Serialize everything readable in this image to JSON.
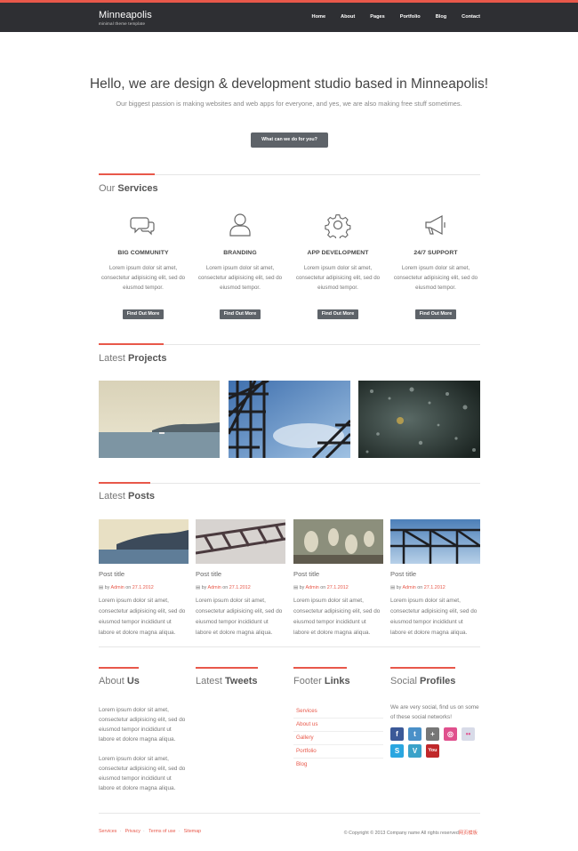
{
  "header": {
    "logo": "Minneapolis",
    "tagline": "minimal theme template",
    "nav": [
      "Home",
      "About",
      "Pages",
      "Portfolio",
      "Blog",
      "Contact"
    ]
  },
  "hero": {
    "title": "Hello, we are design & development studio based in Minneapolis!",
    "subtitle": "Our biggest passion is making websites and web apps for everyone, and yes, we are also making free stuff sometimes.",
    "button": "What can we do for you?"
  },
  "services": {
    "title_light": "Our",
    "title_bold": "Services",
    "items": [
      {
        "icon": "chat-bubbles-icon",
        "title": "BIG COMMUNITY",
        "text": "Lorem ipsum dolor sit amet, consectetur adipisicing elit, sed do eiusmod tempor.",
        "button": "Find Out More"
      },
      {
        "icon": "user-icon",
        "title": "BRANDING",
        "text": "Lorem ipsum dolor sit amet, consectetur adipisicing elit, sed do eiusmod tempor.",
        "button": "Find Out More"
      },
      {
        "icon": "gear-icon",
        "title": "APP DEVELOPMENT",
        "text": "Lorem ipsum dolor sit amet, consectetur adipisicing elit, sed do eiusmod tempor.",
        "button": "Find Out More"
      },
      {
        "icon": "megaphone-icon",
        "title": "24/7 SUPPORT",
        "text": "Lorem ipsum dolor sit amet, consectetur adipisicing elit, sed do eiusmod tempor.",
        "button": "Find Out More"
      }
    ]
  },
  "projects": {
    "title_light": "Latest",
    "title_bold": "Projects"
  },
  "posts": {
    "title_light": "Latest",
    "title_bold": "Posts",
    "items": [
      {
        "title": "Post title",
        "by": "by",
        "author": "Admin",
        "on": "on",
        "date": "27.1.2012",
        "text": "Lorem ipsum dolor sit amet, consectetur adipisicing elit, sed do eiusmod tempor incididunt ut labore et dolore magna aliqua."
      },
      {
        "title": "Post title",
        "by": "by",
        "author": "Admin",
        "on": "on",
        "date": "27.1.2012",
        "text": "Lorem ipsum dolor sit amet, consectetur adipisicing elit, sed do eiusmod tempor incididunt ut labore et dolore magna aliqua."
      },
      {
        "title": "Post title",
        "by": "by",
        "author": "Admin",
        "on": "on",
        "date": "27.1.2012",
        "text": "Lorem ipsum dolor sit amet, consectetur adipisicing elit, sed do eiusmod tempor incididunt ut labore et dolore magna aliqua."
      },
      {
        "title": "Post title",
        "by": "by",
        "author": "Admin",
        "on": "on",
        "date": "27.1.2012",
        "text": "Lorem ipsum dolor sit amet, consectetur adipisicing elit, sed do eiusmod tempor incididunt ut labore et dolore magna aliqua."
      }
    ]
  },
  "about": {
    "title_light": "About",
    "title_bold": "Us",
    "para1": "Lorem ipsum dolor sit amet, consectetur adipisicing elit, sed do eiusmod tempor incididunt ut labore et dolore magna aliqua.",
    "para2": "Lorem ipsum dolor sit amet, consectetur adipisicing elit, sed do eiusmod tempor incididunt ut labore et dolore magna aliqua."
  },
  "tweets": {
    "title_light": "Latest",
    "title_bold": "Tweets"
  },
  "footer_links": {
    "title_light": "Footer",
    "title_bold": "Links",
    "items": [
      "Services",
      "About us",
      "Gallery",
      "Portfolio",
      "Blog"
    ]
  },
  "social": {
    "title_light": "Social",
    "title_bold": "Profiles",
    "text": "We are very social, find us on some of these social networks!",
    "icons": [
      {
        "icon": "facebook-icon",
        "glyph": "f",
        "color": "#3b5998"
      },
      {
        "icon": "twitter-icon",
        "glyph": "t",
        "color": "#4a90c8"
      },
      {
        "icon": "google-plus-icon",
        "glyph": "+",
        "color": "#777777"
      },
      {
        "icon": "dribbble-icon",
        "glyph": "◎",
        "color": "#e0508d"
      },
      {
        "icon": "flickr-icon",
        "glyph": "••",
        "color": "#d8dbe8"
      },
      {
        "icon": "skype-icon",
        "glyph": "S",
        "color": "#2aa6e0"
      },
      {
        "icon": "vimeo-icon",
        "glyph": "V",
        "color": "#3aa2c9"
      },
      {
        "icon": "youtube-icon",
        "glyph": "You",
        "color": "#c0282a"
      }
    ]
  },
  "footer": {
    "links": [
      "Services",
      "Privacy",
      "Terms of use",
      "Sitemap"
    ],
    "copyright": "© Copyright © 2013 Company name All rights reserved",
    "mark": "网页模板"
  },
  "colors": {
    "accent": "#e8584a",
    "topbar": "#2e2f33",
    "button": "#5e6369"
  }
}
